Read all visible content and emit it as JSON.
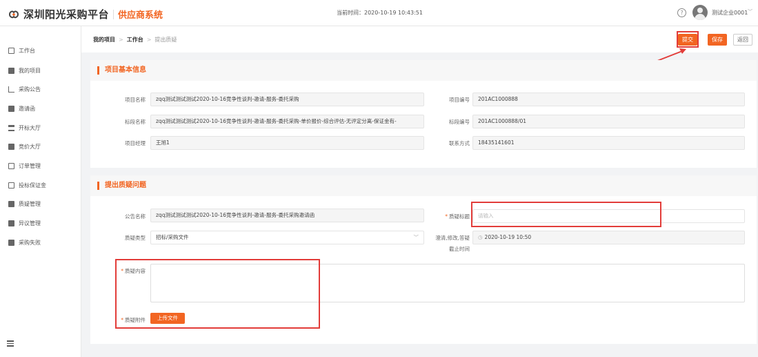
{
  "header": {
    "title": "深圳阳光采购平台",
    "subtitle": "供应商系统",
    "clock_text": "当前时间：2020-10-19 10:43:51",
    "help_label": "?",
    "username": "测试企业0001",
    "caret": "﹀",
    "brand_color": "#f26522"
  },
  "sidebar": {
    "items": [
      {
        "label": "工作台",
        "icon": "monitor-icon"
      },
      {
        "label": "我的项目",
        "icon": "folder-icon"
      },
      {
        "label": "采购公告",
        "icon": "cart-icon"
      },
      {
        "label": "邀请函",
        "icon": "mail-icon"
      },
      {
        "label": "开标大厅",
        "icon": "bank-icon"
      },
      {
        "label": "竞价大厅",
        "icon": "gavel-icon"
      },
      {
        "label": "订单管理",
        "icon": "order-icon"
      },
      {
        "label": "投标保证金",
        "icon": "shield-icon"
      },
      {
        "label": "质疑管理",
        "icon": "doc-icon"
      },
      {
        "label": "异议管理",
        "icon": "folder-icon"
      },
      {
        "label": "采购失败",
        "icon": "fail-icon"
      }
    ]
  },
  "breadcrumb": {
    "items": [
      "我的项目",
      "工作台",
      "提出质疑"
    ],
    "sep": ">"
  },
  "toolbar": {
    "submit_label": "提交",
    "save_label": "保存",
    "back_label": "返回"
  },
  "project_info": {
    "title": "项目基本信息",
    "project_name_label": "项目名称",
    "project_name": "zqq测试测试测试2020-10-16竞争性谈判-邀请-服务-委托采购",
    "project_no_label": "项目编号",
    "project_no": "201AC1000888",
    "section_name_label": "标段名称",
    "section_name": "zqq测试测试测试2020-10-16竞争性谈判-邀请-服务-委托采购-单价报价-综合评估-无评定分离-保证金有-",
    "section_no_label": "标段编号",
    "section_no": "201AC1000888/01",
    "manager_label": "项目经理",
    "manager": "王旭1",
    "contact_label": "联系方式",
    "contact": "18435141601"
  },
  "question_form": {
    "title": "提出质疑问题",
    "notice_label": "公告名称",
    "notice_value": "zqq测试测试测试2020-10-16竞争性谈判-邀请-服务-委托采购邀请函",
    "question_title_label": "质疑标题",
    "question_title_placeholder": "请输入",
    "type_label": "质疑类型",
    "type_value": "招标/采购文件",
    "deadline_label_1": "澄清,修改,答疑",
    "deadline_label_2": "截止时间",
    "deadline_value": "2020-10-19 10:50",
    "content_label": "质疑内容",
    "attachment_label": "质疑附件",
    "upload_label": "上传文件",
    "required_mark": "*"
  }
}
